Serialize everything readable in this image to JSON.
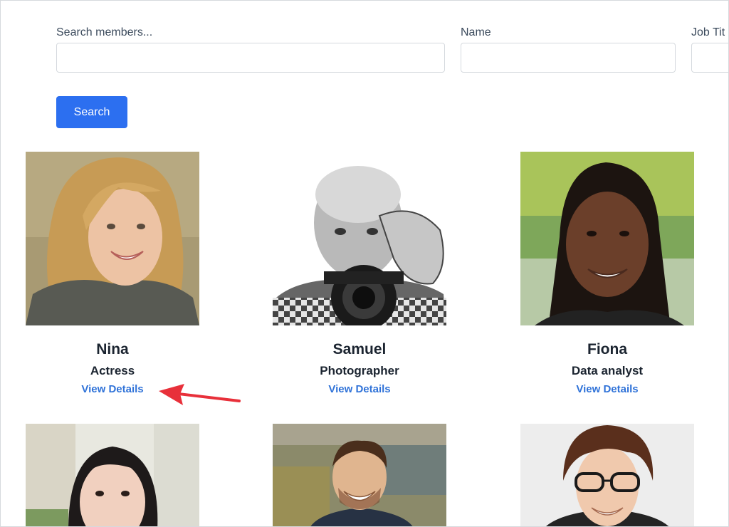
{
  "search": {
    "members_label": "Search members...",
    "name_label": "Name",
    "job_label": "Job Tit",
    "button_label": "Search"
  },
  "members": [
    {
      "name": "Nina",
      "title": "Actress",
      "link": "View Details"
    },
    {
      "name": "Samuel",
      "title": "Photographer",
      "link": "View Details"
    },
    {
      "name": "Fiona",
      "title": "Data analyst",
      "link": "View Details"
    }
  ],
  "colors": {
    "accent": "#2c6ff0",
    "link": "#2f72d8",
    "annotation_arrow": "#e8303a"
  }
}
